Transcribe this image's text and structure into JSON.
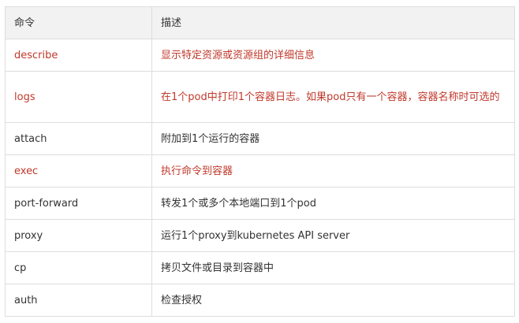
{
  "table": {
    "headers": [
      "命令",
      "描述"
    ],
    "rows": [
      {
        "command": "describe",
        "description": "显示特定资源或资源组的详细信息",
        "highlight": true
      },
      {
        "command": "logs",
        "description": "在1个pod中打印1个容器日志。如果pod只有一个容器，容器名称时可选的",
        "highlight": true
      },
      {
        "command": "attach",
        "description": "附加到1个运行的容器",
        "highlight": false
      },
      {
        "command": "exec",
        "description": "执行命令到容器",
        "highlight": true
      },
      {
        "command": "port-forward",
        "description": "转发1个或多个本地端口到1个pod",
        "highlight": false
      },
      {
        "command": "proxy",
        "description": "运行1个proxy到kubernetes API server",
        "highlight": false
      },
      {
        "command": "cp",
        "description": "拷贝文件或目录到容器中",
        "highlight": false
      },
      {
        "command": "auth",
        "description": "检查授权",
        "highlight": false
      }
    ]
  },
  "colors": {
    "highlight_text": "#c0392b",
    "header_background": "#f2f2f2",
    "border": "#dddddd",
    "text": "#333333"
  }
}
